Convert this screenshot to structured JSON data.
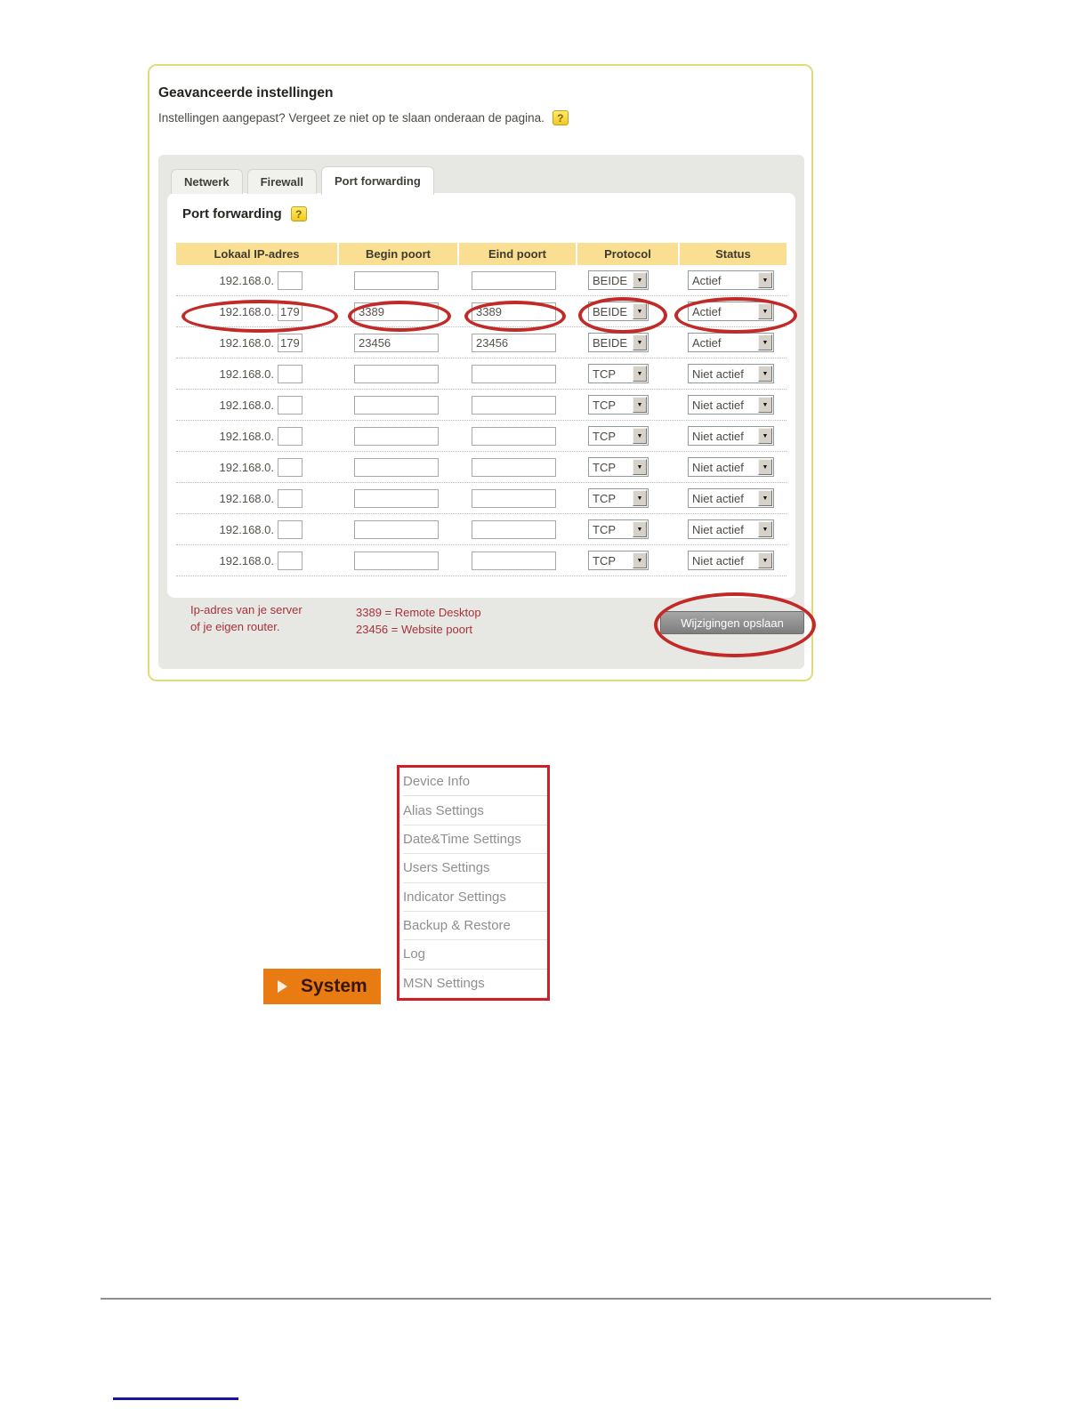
{
  "advanced_settings": {
    "title": "Geavanceerde instellingen",
    "subtitle": "Instellingen aangepast? Vergeet ze niet op te slaan onderaan de pagina.",
    "help_icon_glyph": "?",
    "tabs": [
      {
        "label": "Netwerk",
        "active": false
      },
      {
        "label": "Firewall",
        "active": false
      },
      {
        "label": "Port forwarding",
        "active": true
      }
    ],
    "section": {
      "title": "Port forwarding",
      "help_icon_glyph": "?"
    },
    "table": {
      "headers": [
        "Lokaal IP-adres",
        "Begin poort",
        "Eind poort",
        "Protocol",
        "Status"
      ],
      "ip_prefix": "192.168.0.",
      "rows": [
        {
          "ip_suffix": "",
          "begin_port": "",
          "end_port": "",
          "protocol": "BEIDE",
          "status": "Actief",
          "annotated": false
        },
        {
          "ip_suffix": "179",
          "begin_port": "3389",
          "end_port": "3389",
          "protocol": "BEIDE",
          "status": "Actief",
          "annotated": true
        },
        {
          "ip_suffix": "179",
          "begin_port": "23456",
          "end_port": "23456",
          "protocol": "BEIDE",
          "status": "Actief",
          "annotated": false
        },
        {
          "ip_suffix": "",
          "begin_port": "",
          "end_port": "",
          "protocol": "TCP",
          "status": "Niet actief",
          "annotated": false
        },
        {
          "ip_suffix": "",
          "begin_port": "",
          "end_port": "",
          "protocol": "TCP",
          "status": "Niet actief",
          "annotated": false
        },
        {
          "ip_suffix": "",
          "begin_port": "",
          "end_port": "",
          "protocol": "TCP",
          "status": "Niet actief",
          "annotated": false
        },
        {
          "ip_suffix": "",
          "begin_port": "",
          "end_port": "",
          "protocol": "TCP",
          "status": "Niet actief",
          "annotated": false
        },
        {
          "ip_suffix": "",
          "begin_port": "",
          "end_port": "",
          "protocol": "TCP",
          "status": "Niet actief",
          "annotated": false
        },
        {
          "ip_suffix": "",
          "begin_port": "",
          "end_port": "",
          "protocol": "TCP",
          "status": "Niet actief",
          "annotated": false
        },
        {
          "ip_suffix": "",
          "begin_port": "",
          "end_port": "",
          "protocol": "TCP",
          "status": "Niet actief",
          "annotated": false
        }
      ]
    },
    "footer": {
      "note_server": [
        "Ip-adres van je server",
        "of je eigen router."
      ],
      "note_ports": [
        "3389 = Remote Desktop",
        "23456 = Website poort"
      ],
      "save_button_label": "Wijzigingen opslaan"
    }
  },
  "system_menu": {
    "button_label": "System",
    "items": [
      "Device Info",
      "Alias Settings",
      "Date&Time Settings",
      "Users Settings",
      "Indicator Settings",
      "Backup & Restore",
      "Log",
      "MSN Settings"
    ]
  },
  "icons": {
    "dropdown_arrow": "▼"
  },
  "colors": {
    "container_border": "#dfdc7a",
    "tab_panel_bg": "#e7e7e3",
    "table_header_bg": "#fadf92",
    "annotation_red": "#c22a28",
    "note_text_red": "#a8323c",
    "save_button_bg": "#8c8c8c",
    "system_button_orange": "#e87c13",
    "menu_border_red": "#ce2127",
    "menu_text_gray": "#8f8f8f",
    "help_icon_yellow": "#f2c81e"
  }
}
